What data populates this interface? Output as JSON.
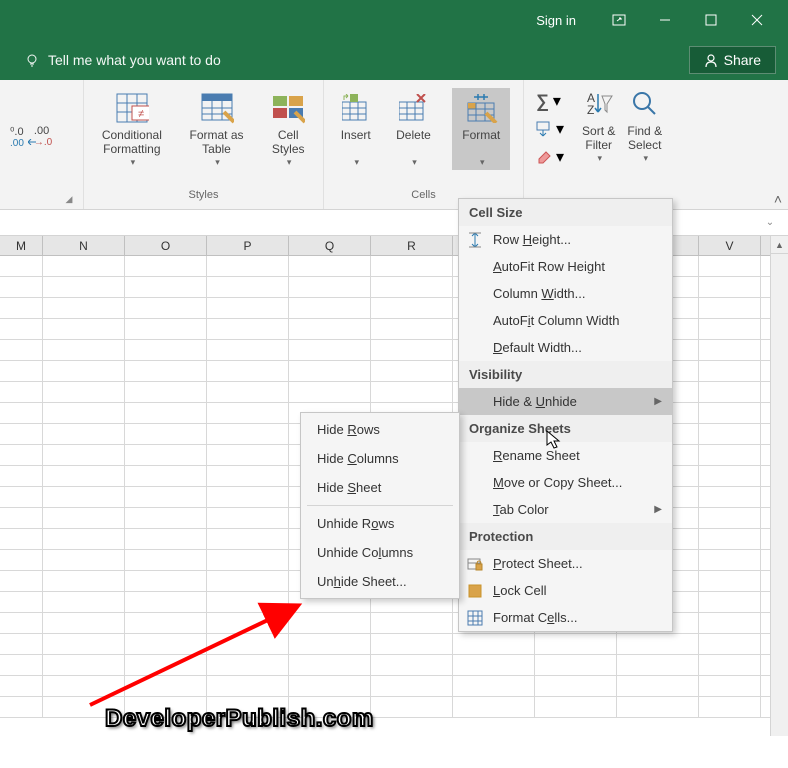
{
  "titlebar": {
    "signin": "Sign in"
  },
  "tellme": {
    "placeholder": "Tell me what you want to do"
  },
  "share": {
    "label": "Share"
  },
  "ribbon": {
    "number_decrease": ".0",
    "number_increase": ".00",
    "conditional": "Conditional\nFormatting",
    "format_as_table": "Format as\nTable",
    "cell_styles": "Cell\nStyles",
    "insert": "Insert",
    "delete": "Delete",
    "format": "Format",
    "sort_filter": "Sort &\nFilter",
    "find_select": "Find &\nSelect",
    "group_number": "",
    "group_styles": "Styles",
    "group_cells": "Cells",
    "group_editing": ""
  },
  "columns": [
    "M",
    "N",
    "O",
    "P",
    "Q",
    "R",
    "",
    "",
    "",
    "V"
  ],
  "format_menu": {
    "cell_size": "Cell Size",
    "row_height": "Row Height...",
    "autofit_row": "AutoFit Row Height",
    "col_width": "Column Width...",
    "autofit_col": "AutoFit Column Width",
    "default_width": "Default Width...",
    "visibility": "Visibility",
    "hide_unhide": "Hide & Unhide",
    "organize": "Organize Sheets",
    "rename": "Rename Sheet",
    "move_copy": "Move or Copy Sheet...",
    "tab_color": "Tab Color",
    "protection": "Protection",
    "protect_sheet": "Protect Sheet...",
    "lock_cell": "Lock Cell",
    "format_cells": "Format Cells..."
  },
  "submenu": {
    "hide_rows": "Hide Rows",
    "hide_cols": "Hide Columns",
    "hide_sheet": "Hide Sheet",
    "unhide_rows": "Unhide Rows",
    "unhide_cols": "Unhide Columns",
    "unhide_sheet": "Unhide Sheet..."
  },
  "watermark": "DeveloperPublish.com"
}
